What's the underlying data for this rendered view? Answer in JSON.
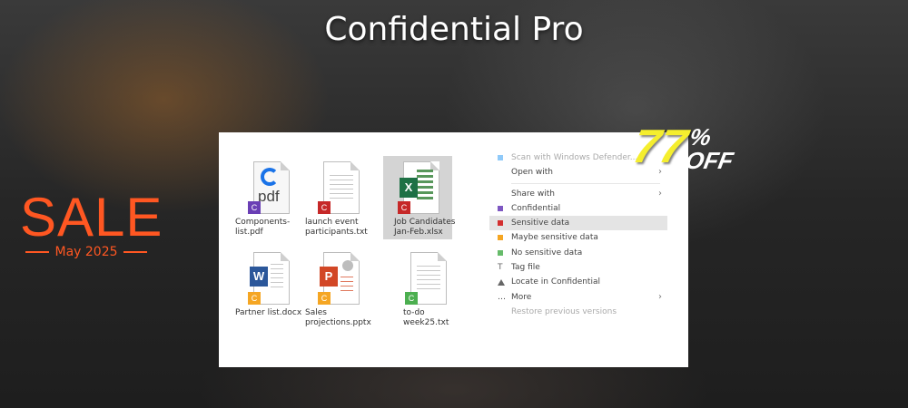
{
  "title": "Confidential Pro",
  "sale": {
    "word": "SALE",
    "date": "May 2025"
  },
  "discount": {
    "number": "77",
    "percent": "%",
    "off": "OFF"
  },
  "colors": {
    "sale": "#ff5722",
    "discount": "#f5ee2e"
  },
  "files": [
    {
      "name": "Components-list.pdf",
      "badge": "C",
      "icon": "edge-pdf-icon",
      "app_text": "pdf"
    },
    {
      "name": "launch event participants.txt",
      "badge": "C",
      "icon": "text-doc-icon"
    },
    {
      "name": "Job Candidates Jan-Feb.xlsx",
      "badge": "C",
      "icon": "excel-icon",
      "app_text": "X"
    },
    {
      "name": "Partner list.docx",
      "badge": "C",
      "icon": "word-icon",
      "app_text": "W"
    },
    {
      "name": "Sales projections.pptx",
      "badge": "C",
      "icon": "powerpoint-icon",
      "app_text": "P"
    },
    {
      "name": "to-do week25.txt",
      "badge": "C",
      "icon": "text-doc-icon"
    }
  ],
  "context_menu": [
    {
      "label": "Scan with Windows Defender...",
      "icon": "defender-icon",
      "dim": true
    },
    {
      "label": "Open with",
      "arrow": true
    },
    {
      "label": "Share with",
      "arrow": true
    },
    {
      "label": "Confidential",
      "icon": "confidential-icon"
    },
    {
      "label": "Sensitive data",
      "icon": "sensitive-red-icon",
      "highlighted": true
    },
    {
      "label": "Maybe sensitive data",
      "icon": "maybe-orange-icon"
    },
    {
      "label": "No sensitive data",
      "icon": "no-sensitive-green-icon"
    },
    {
      "label": "Tag file",
      "icon": "tag-icon"
    },
    {
      "label": "Locate in Confidential",
      "icon": "locate-icon"
    },
    {
      "label": "More",
      "arrow": true
    },
    {
      "label": "Restore previous versions",
      "dim": true
    }
  ]
}
